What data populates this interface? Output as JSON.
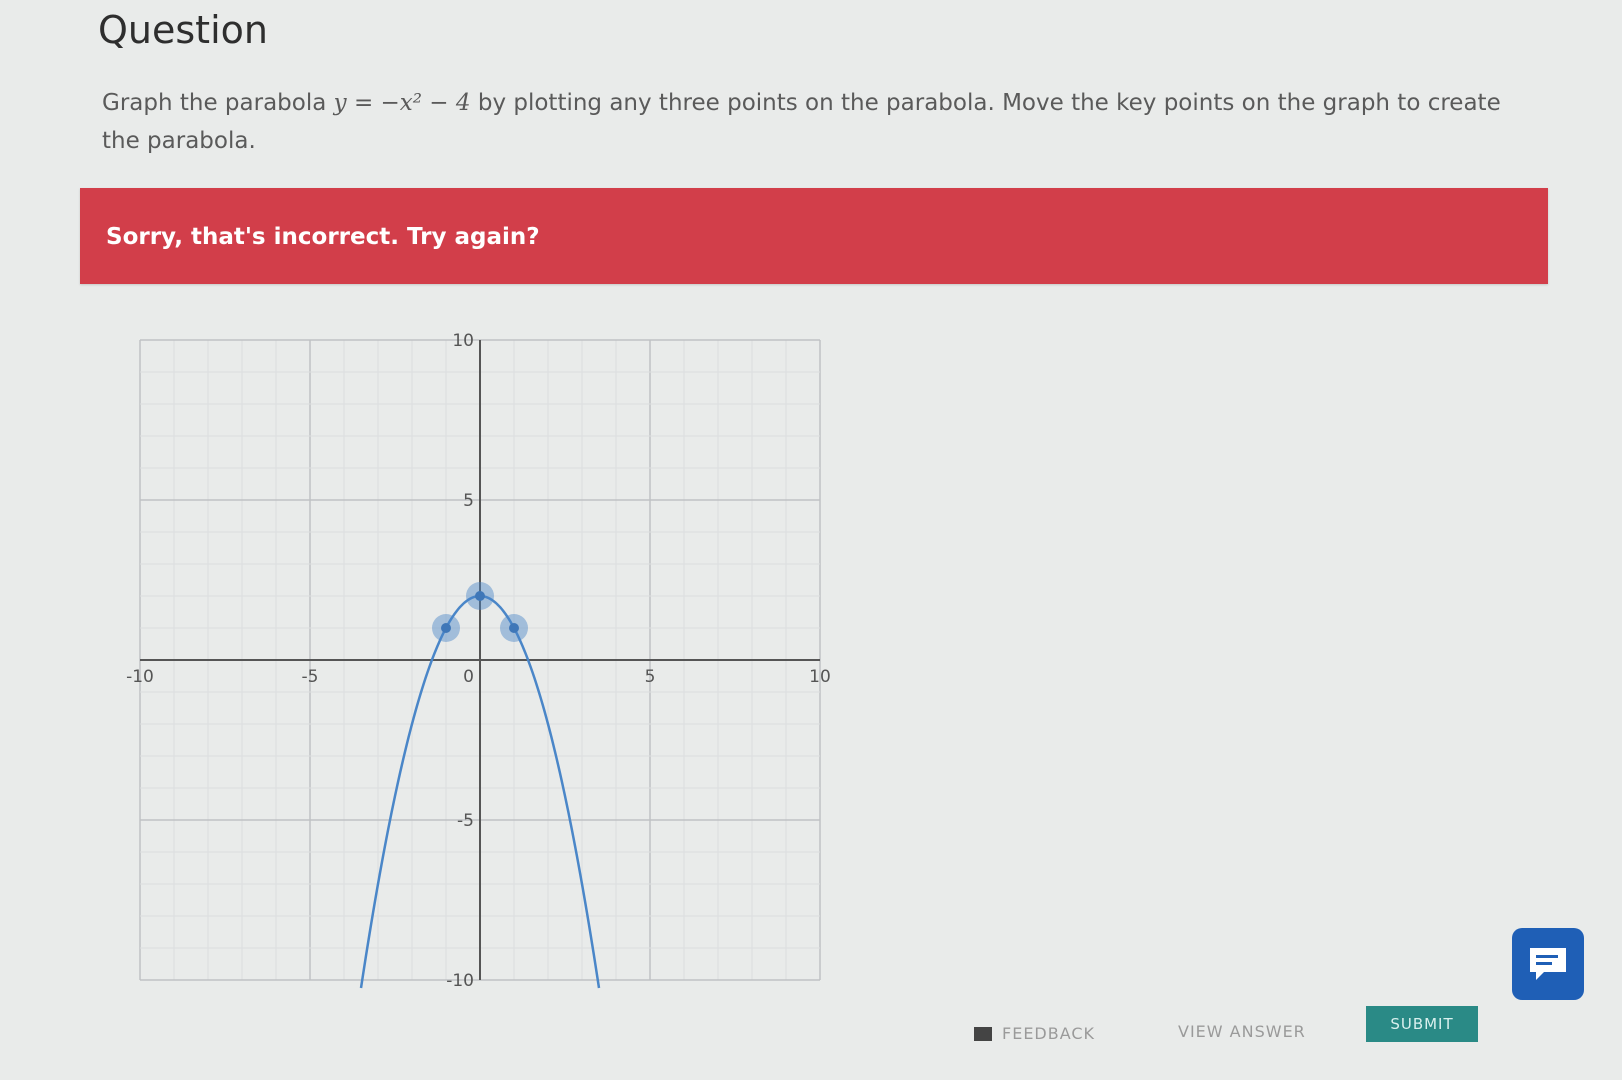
{
  "question": {
    "heading": "Question",
    "prompt_before": "Graph the parabola",
    "equation": "y = −x² − 4",
    "prompt_after": "by plotting any three points on the parabola. Move the key points on the graph to create the parabola."
  },
  "feedback": {
    "message": "Sorry, that's incorrect. Try again?",
    "color": "#d23e4a"
  },
  "chart_data": {
    "type": "scatter",
    "xlim": [
      -10,
      10
    ],
    "ylim": [
      -10,
      10
    ],
    "grid": true,
    "x_ticks": [
      {
        "value": -10,
        "label": "-10"
      },
      {
        "value": -5,
        "label": "-5"
      },
      {
        "value": 5,
        "label": "5"
      },
      {
        "value": 10,
        "label": "10"
      }
    ],
    "y_ticks": [
      {
        "value": 10,
        "label": "10"
      },
      {
        "value": 5,
        "label": "5"
      },
      {
        "value": -5,
        "label": "-5"
      },
      {
        "value": -10,
        "label": "-10"
      }
    ],
    "origin_label": "0",
    "curve": {
      "a": -1,
      "h": 0,
      "k": 2,
      "color": "#4a86c8"
    },
    "key_points": [
      {
        "x": -1,
        "y": 1
      },
      {
        "x": 0,
        "y": 2
      },
      {
        "x": 1,
        "y": 1
      }
    ]
  },
  "actions": {
    "feedback_label": "FEEDBACK",
    "view_answer_label": "VIEW ANSWER",
    "submit_label": "SUBMIT"
  }
}
